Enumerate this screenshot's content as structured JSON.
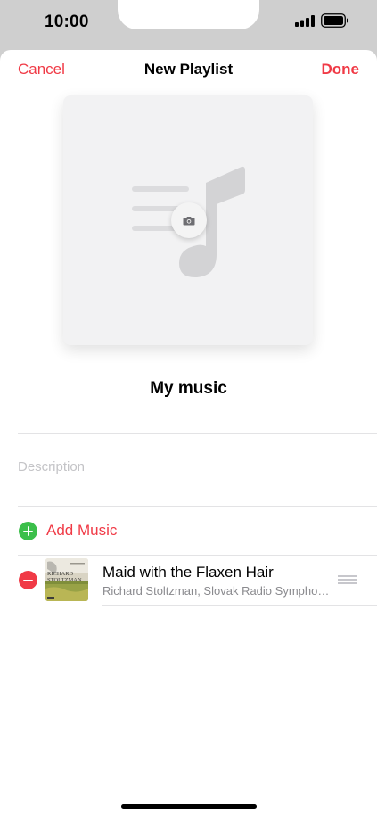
{
  "status_bar": {
    "time": "10:00",
    "icons": [
      "signal-icon",
      "battery-icon"
    ]
  },
  "nav": {
    "cancel_label": "Cancel",
    "title": "New Playlist",
    "done_label": "Done"
  },
  "artwork": {
    "icons": [
      "music-note-icon",
      "camera-icon"
    ]
  },
  "playlist": {
    "name": "My music",
    "description_placeholder": "Description"
  },
  "add_music": {
    "label": "Add Music",
    "icon": "add-icon"
  },
  "songs": [
    {
      "title": "Maid with the Flaxen Hair",
      "subtitle": "Richard Stoltzman, Slovak Radio Sympho…",
      "artwork_text": [
        "RICHARD",
        "STOLTZMAN"
      ]
    }
  ],
  "colors": {
    "accent": "#f03a46",
    "add_green": "#3bbf4a",
    "placeholder_gray": "#c4c4c7",
    "secondary_text": "#8a8a8e"
  }
}
